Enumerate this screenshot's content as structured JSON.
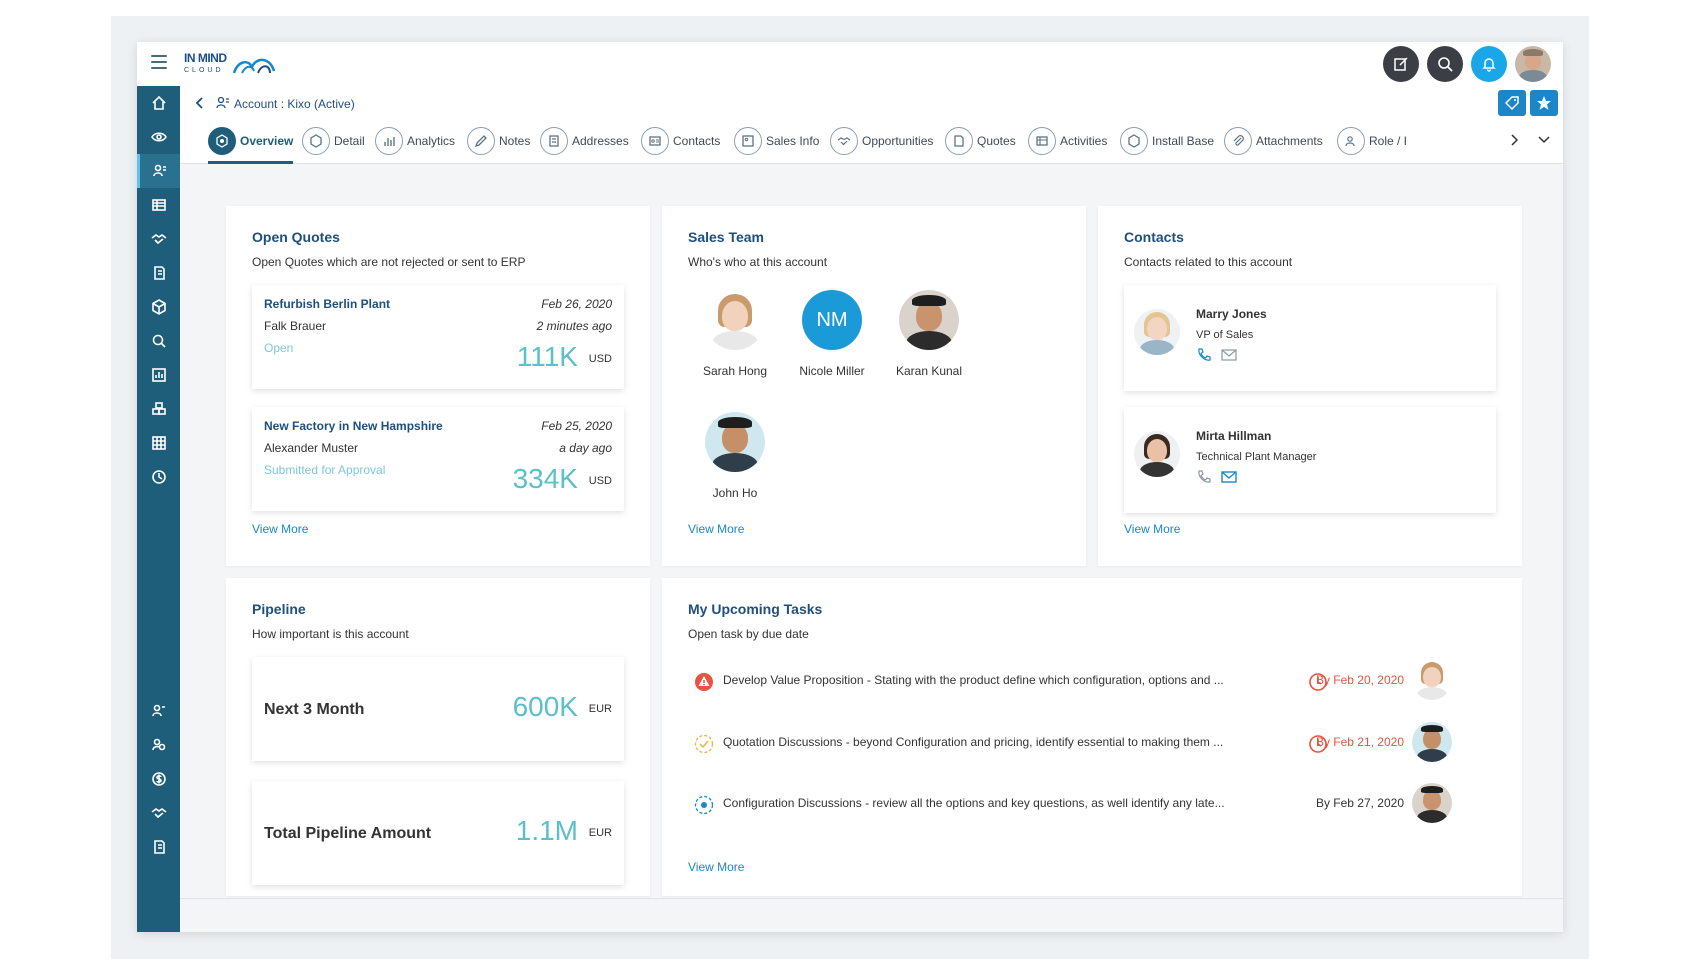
{
  "app": {
    "logo_line1": "IN MIND",
    "logo_line2": "CLOUD"
  },
  "breadcrumb": {
    "text": "Account : Kixo (Active)"
  },
  "tabs": [
    {
      "label": "Overview"
    },
    {
      "label": "Detail"
    },
    {
      "label": "Analytics"
    },
    {
      "label": "Notes"
    },
    {
      "label": "Addresses"
    },
    {
      "label": "Contacts"
    },
    {
      "label": "Sales Info"
    },
    {
      "label": "Opportunities"
    },
    {
      "label": "Quotes"
    },
    {
      "label": "Activities"
    },
    {
      "label": "Install Base"
    },
    {
      "label": "Attachments"
    },
    {
      "label": "Role / I"
    }
  ],
  "open_quotes": {
    "title": "Open Quotes",
    "subtitle": "Open Quotes which are not rejected or sent to ERP",
    "items": [
      {
        "title": "Refurbish Berlin Plant",
        "person": "Falk Brauer",
        "status": "Open",
        "date": "Feb 26, 2020",
        "ago": "2 minutes ago",
        "amount": "111K",
        "currency": "USD"
      },
      {
        "title": "New Factory in New Hampshire",
        "person": "Alexander Muster",
        "status": "Submitted for Approval",
        "date": "Feb 25, 2020",
        "ago": "a day ago",
        "amount": "334K",
        "currency": "USD"
      }
    ],
    "view_more": "View More"
  },
  "sales_team": {
    "title": "Sales Team",
    "subtitle": "Who's who at this account",
    "members": [
      {
        "name": "Sarah Hong"
      },
      {
        "name": "Nicole Miller",
        "initials": "NM"
      },
      {
        "name": "Karan Kunal"
      },
      {
        "name": "John Ho"
      }
    ],
    "view_more": "View More"
  },
  "contacts": {
    "title": "Contacts",
    "subtitle": "Contacts related to this account",
    "items": [
      {
        "name": "Marry Jones",
        "role": "VP of Sales"
      },
      {
        "name": "Mirta Hillman",
        "role": "Technical Plant Manager"
      }
    ],
    "view_more": "View More"
  },
  "pipeline": {
    "title": "Pipeline",
    "subtitle": "How important is this account",
    "items": [
      {
        "label": "Next 3 Month",
        "amount": "600K",
        "currency": "EUR"
      },
      {
        "label": "Total Pipeline Amount",
        "amount": "1.1M",
        "currency": "EUR"
      }
    ]
  },
  "tasks": {
    "title": "My Upcoming Tasks",
    "subtitle": "Open task by due date",
    "items": [
      {
        "text": "Develop Value Proposition - Stating with the product define which configuration, options and ...",
        "due": "By Feb 20, 2020"
      },
      {
        "text": "Quotation Discussions - beyond Configuration and pricing, identify essential to making them ...",
        "due": "By Feb 21, 2020"
      },
      {
        "text": "Configuration Discussions - review all the options and key questions, as well identify any late...",
        "due": "By Feb 27, 2020"
      }
    ],
    "view_more": "View More"
  },
  "colors": {
    "sidebar": "#1f5e7a",
    "accent": "#1b87c9",
    "amount": "#5cc0c9",
    "overdue": "#e8533f"
  }
}
